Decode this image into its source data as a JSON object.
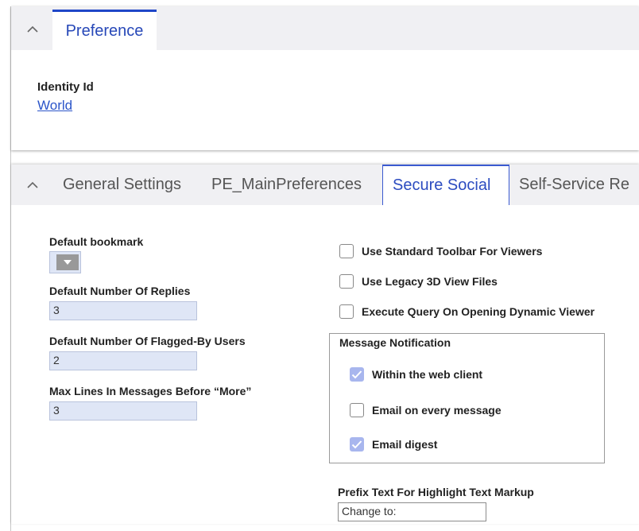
{
  "preference_panel": {
    "tab_label": "Preference",
    "identity_label": "Identity Id",
    "identity_value": "World"
  },
  "settings_panel": {
    "tabs": [
      "General Settings",
      "PE_MainPreferences",
      "Secure Social",
      "Self-Service Re"
    ],
    "active_tab": "Secure Social"
  },
  "left_fields": {
    "default_bookmark_label": "Default bookmark",
    "default_replies_label": "Default Number Of Replies",
    "default_replies_value": "3",
    "default_flagged_label": "Default Number Of Flagged-By Users",
    "default_flagged_value": "2",
    "max_lines_label": "Max Lines In Messages Before “More”",
    "max_lines_value": "3"
  },
  "right_options": {
    "use_standard_toolbar": {
      "label": "Use Standard Toolbar For Viewers",
      "checked": false
    },
    "use_legacy_3d": {
      "label": "Use Legacy 3D View Files",
      "checked": false
    },
    "execute_query": {
      "label": "Execute Query On Opening Dynamic Viewer",
      "checked": false
    }
  },
  "message_notification": {
    "title": "Message Notification",
    "within_web_client": {
      "label": "Within the web client",
      "checked": true
    },
    "email_every_message": {
      "label": "Email on every message",
      "checked": false
    },
    "email_digest": {
      "label": "Email digest",
      "checked": true
    }
  },
  "prefix_text": {
    "label": "Prefix Text For Highlight Text Markup",
    "value": "Change to:"
  },
  "colors": {
    "accent": "#1f46c8",
    "checked": "#a8b6ee",
    "field_bg": "#dfe6f6",
    "tabbar_bg": "#f0f0f3"
  }
}
